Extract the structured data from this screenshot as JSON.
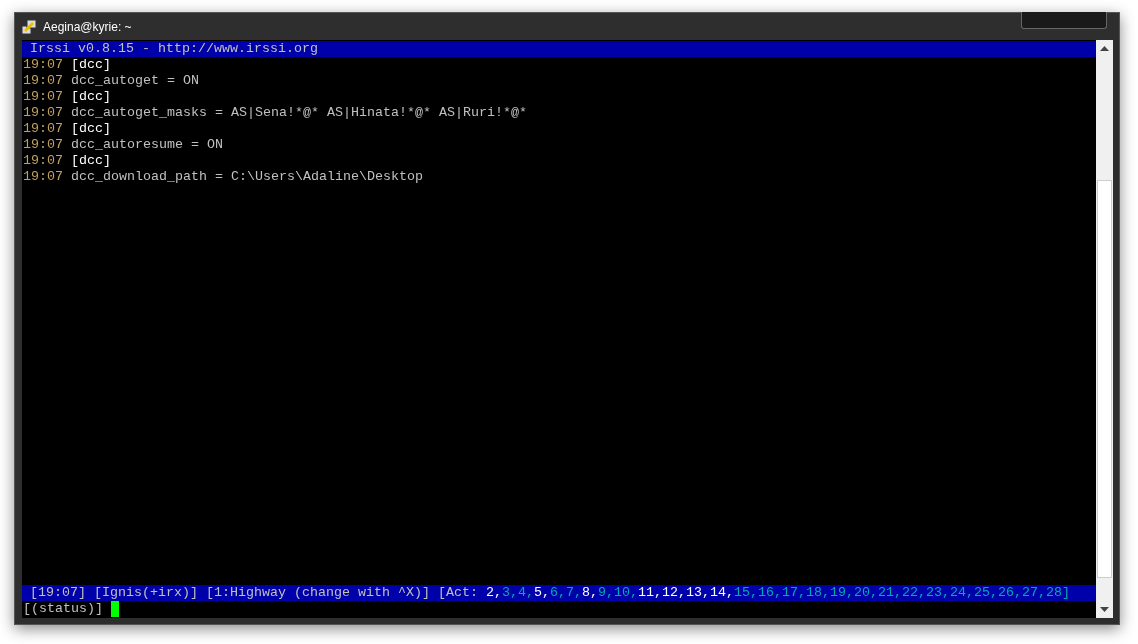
{
  "window": {
    "title": "Aegina@kyrie: ~"
  },
  "topic": "Irssi v0.8.15 - http://www.irssi.org",
  "lines": [
    {
      "time": "19:07",
      "kind": "section",
      "text": "[dcc]"
    },
    {
      "time": "19:07",
      "kind": "setting",
      "text": "dcc_autoget = ON"
    },
    {
      "time": "19:07",
      "kind": "section",
      "text": "[dcc]"
    },
    {
      "time": "19:07",
      "kind": "setting",
      "text": "dcc_autoget_masks = AS|Sena!*@* AS|Hinata!*@* AS|Ruri!*@*"
    },
    {
      "time": "19:07",
      "kind": "section",
      "text": "[dcc]"
    },
    {
      "time": "19:07",
      "kind": "setting",
      "text": "dcc_autoresume = ON"
    },
    {
      "time": "19:07",
      "kind": "section",
      "text": "[dcc]"
    },
    {
      "time": "19:07",
      "kind": "setting",
      "text": "dcc_download_path = C:\\Users\\Adaline\\Desktop"
    }
  ],
  "status_bar": {
    "time": "[19:07]",
    "nick": "[Ignis(+irx)]",
    "window": "[1:Highway (change with ^X)]",
    "act_label": "[Act:",
    "act": [
      {
        "text": "2,",
        "highlighted": true
      },
      {
        "text": "3,",
        "highlighted": false
      },
      {
        "text": "4,",
        "highlighted": false
      },
      {
        "text": "5,",
        "highlighted": true
      },
      {
        "text": "6,",
        "highlighted": false
      },
      {
        "text": "7,",
        "highlighted": false
      },
      {
        "text": "8,",
        "highlighted": true
      },
      {
        "text": "9,",
        "highlighted": false
      },
      {
        "text": "10,",
        "highlighted": false
      },
      {
        "text": "11,",
        "highlighted": true
      },
      {
        "text": "12,",
        "highlighted": true
      },
      {
        "text": "13,",
        "highlighted": true
      },
      {
        "text": "14,",
        "highlighted": true
      },
      {
        "text": "15,",
        "highlighted": false
      },
      {
        "text": "16,",
        "highlighted": false
      },
      {
        "text": "17,",
        "highlighted": false
      },
      {
        "text": "18,",
        "highlighted": false
      },
      {
        "text": "19,",
        "highlighted": false
      },
      {
        "text": "20,",
        "highlighted": false
      },
      {
        "text": "21,",
        "highlighted": false
      },
      {
        "text": "22,",
        "highlighted": false
      },
      {
        "text": "23,",
        "highlighted": false
      },
      {
        "text": "24,",
        "highlighted": false
      },
      {
        "text": "25,",
        "highlighted": false
      },
      {
        "text": "26,",
        "highlighted": false
      },
      {
        "text": "27,",
        "highlighted": false
      },
      {
        "text": "28]",
        "highlighted": false
      }
    ]
  },
  "prompt": "[(status)]"
}
